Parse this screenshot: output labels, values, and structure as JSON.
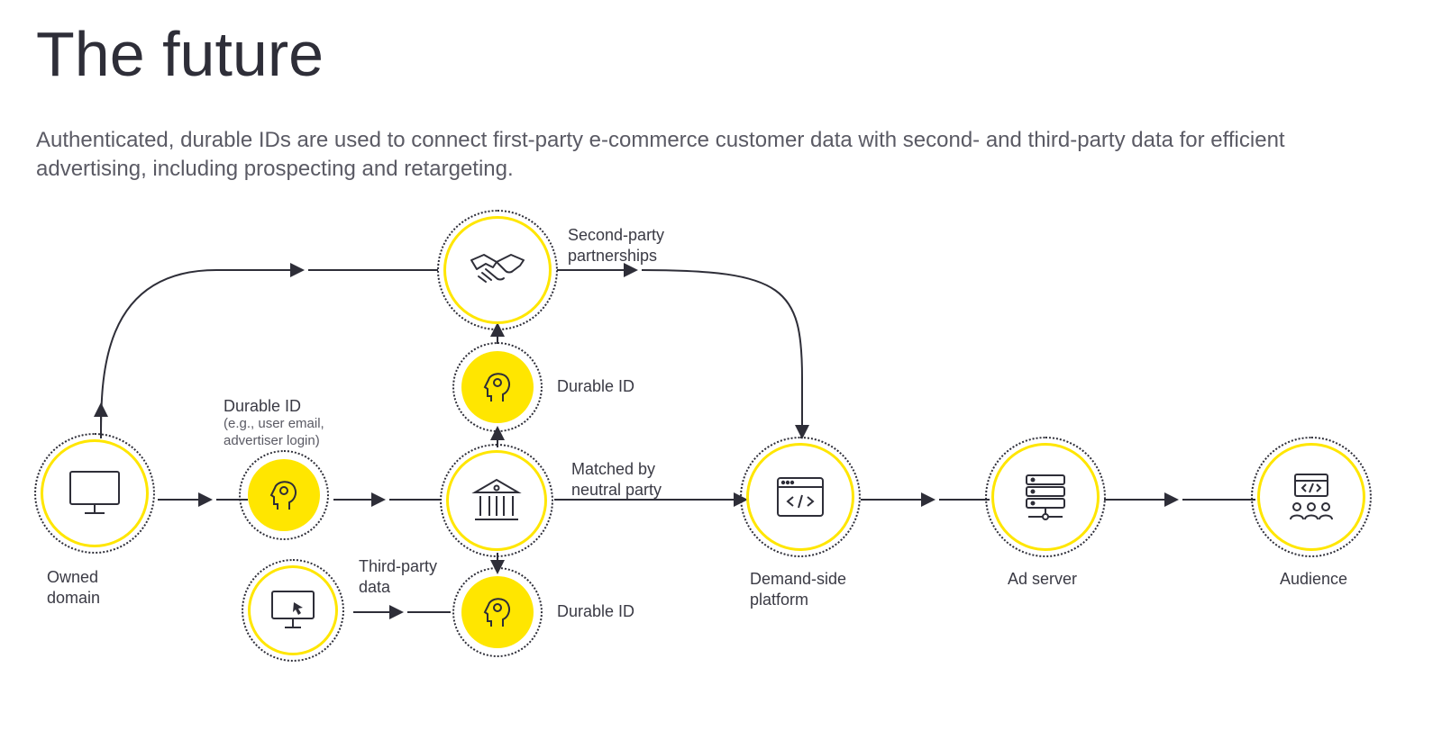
{
  "title": "The future",
  "subtitle": "Authenticated, durable IDs are used to connect first-party e-commerce customer data with second- and third-party data for efficient advertising, including prospecting and retargeting.",
  "colors": {
    "yellow": "#ffe600",
    "ink": "#2e2e38"
  },
  "nodes": {
    "owned_domain": {
      "label": "Owned\ndomain",
      "icon": "monitor"
    },
    "durable_id_1": {
      "label": "Durable ID",
      "sublabel": "(e.g., user email,\nadvertiser login)",
      "icon": "head"
    },
    "neutral_party": {
      "label": "Matched by\nneutral party",
      "icon": "bank"
    },
    "durable_id_top": {
      "label": "Durable ID",
      "icon": "head"
    },
    "durable_id_bottom": {
      "label": "Durable ID",
      "icon": "head"
    },
    "third_party": {
      "label": "Third-party\ndata",
      "icon": "monitor-cursor"
    },
    "second_party": {
      "label": "Second-party\npartnerships",
      "icon": "handshake"
    },
    "dsp": {
      "label": "Demand-side\nplatform",
      "icon": "browser-code"
    },
    "ad_server": {
      "label": "Ad server",
      "icon": "server"
    },
    "audience": {
      "label": "Audience",
      "icon": "audience"
    }
  },
  "edges": [
    [
      "owned_domain",
      "durable_id_1"
    ],
    [
      "durable_id_1",
      "neutral_party"
    ],
    [
      "neutral_party",
      "durable_id_top"
    ],
    [
      "durable_id_top",
      "second_party"
    ],
    [
      "neutral_party",
      "durable_id_bottom"
    ],
    [
      "third_party",
      "durable_id_bottom"
    ],
    [
      "neutral_party",
      "dsp"
    ],
    [
      "owned_domain",
      "second_party"
    ],
    [
      "second_party",
      "dsp"
    ],
    [
      "dsp",
      "ad_server"
    ],
    [
      "ad_server",
      "audience"
    ]
  ]
}
